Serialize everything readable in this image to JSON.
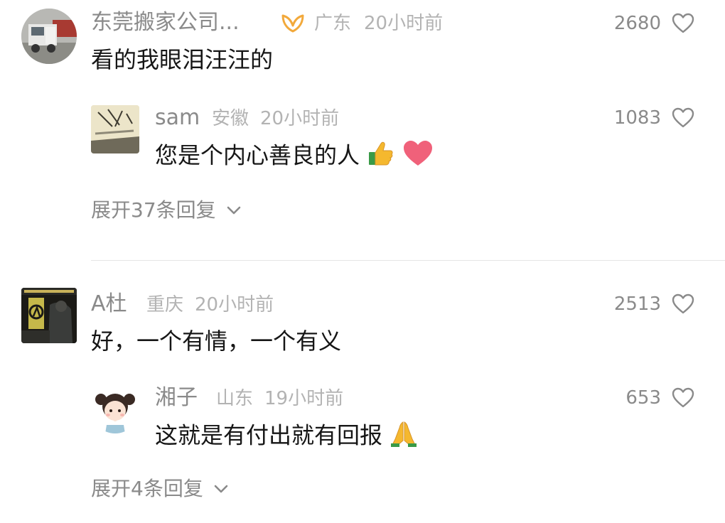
{
  "comments": [
    {
      "user": "东莞搬家公司...",
      "badge_icon": "vip-ribbon-icon",
      "location": "广东",
      "time": "20小时前",
      "text": "看的我眼泪汪汪的",
      "likes": "2680",
      "reply": {
        "user": "sam",
        "location": "安徽",
        "time": "20小时前",
        "text": "您是个内心善良的人",
        "emojis": [
          "thumbs-up-icon",
          "heart-emoji-icon"
        ],
        "likes": "1083"
      },
      "expand_label": "展开37条回复"
    },
    {
      "user": "A杜",
      "location": "重庆",
      "time": "20小时前",
      "text": "好，一个有情，一个有义",
      "likes": "2513",
      "reply": {
        "user": "湘子",
        "location": "山东",
        "time": "19小时前",
        "text": "这就是有付出就有回报",
        "emojis": [
          "praying-hands-icon"
        ],
        "likes": "653"
      },
      "expand_label": "展开4条回复"
    }
  ],
  "colors": {
    "name": "#8a8a8a",
    "meta": "#b3b3b3",
    "text": "#161616",
    "badge": "#f2a93b",
    "heart_emoji": "#f0617a"
  }
}
